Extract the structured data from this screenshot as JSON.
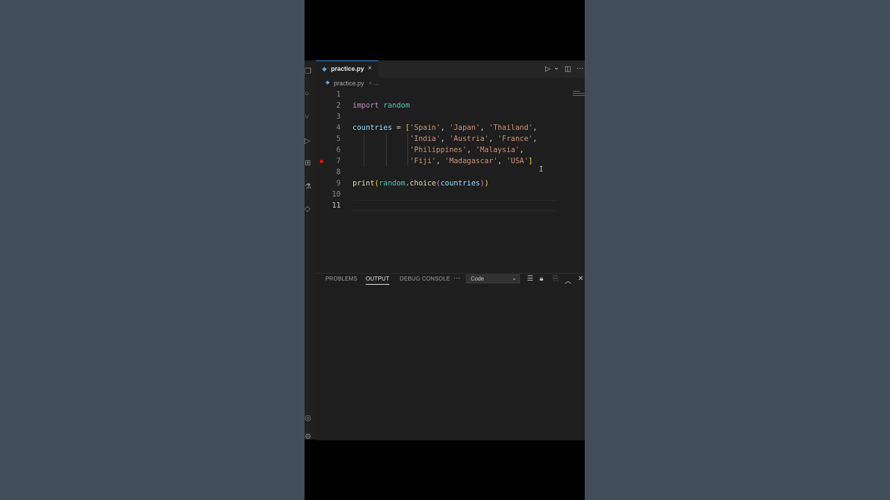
{
  "tab": {
    "filename": "practice.py",
    "close": "×"
  },
  "breadcrumb": {
    "file": "practice.py",
    "sep": "›  …"
  },
  "toolbar": {
    "run": "▷",
    "run_menu": "⌄",
    "split": "◫",
    "more": "···"
  },
  "code_lines": [
    {
      "num": "1"
    },
    {
      "num": "2",
      "tokens": [
        [
          "kw",
          "import"
        ],
        [
          "op",
          " "
        ],
        [
          "mod",
          "random"
        ]
      ]
    },
    {
      "num": "3"
    },
    {
      "num": "4",
      "tokens": [
        [
          "var",
          "countries"
        ],
        [
          "op",
          " = "
        ],
        [
          "br",
          "["
        ],
        [
          "str",
          "'Spain'"
        ],
        [
          "op",
          ", "
        ],
        [
          "str",
          "'Japan'"
        ],
        [
          "op",
          ", "
        ],
        [
          "str",
          "'Thailand'"
        ],
        [
          "op",
          ","
        ]
      ]
    },
    {
      "num": "5",
      "tokens": [
        [
          "op",
          "             "
        ],
        [
          "str",
          "'India'"
        ],
        [
          "op",
          ", "
        ],
        [
          "str",
          "'Austria'"
        ],
        [
          "op",
          ", "
        ],
        [
          "str",
          "'France'"
        ],
        [
          "op",
          ","
        ]
      ]
    },
    {
      "num": "6",
      "tokens": [
        [
          "op",
          "             "
        ],
        [
          "str",
          "'Philippines'"
        ],
        [
          "op",
          ", "
        ],
        [
          "str",
          "'Malaysia'"
        ],
        [
          "op",
          ","
        ]
      ]
    },
    {
      "num": "7",
      "tokens": [
        [
          "op",
          "             "
        ],
        [
          "str",
          "'Fiji'"
        ],
        [
          "op",
          ", "
        ],
        [
          "str",
          "'Madagascar'"
        ],
        [
          "op",
          ", "
        ],
        [
          "str",
          "'USA'"
        ],
        [
          "br",
          "]"
        ]
      ]
    },
    {
      "num": "8"
    },
    {
      "num": "9",
      "tokens": [
        [
          "fn",
          "print"
        ],
        [
          "br",
          "("
        ],
        [
          "mod",
          "random"
        ],
        [
          "op",
          "."
        ],
        [
          "fn",
          "choice"
        ],
        [
          "br2",
          "("
        ],
        [
          "var",
          "countries"
        ],
        [
          "br2",
          ")"
        ],
        [
          "br",
          ")"
        ]
      ]
    },
    {
      "num": "10"
    },
    {
      "num": "11"
    }
  ],
  "panel": {
    "tabs": [
      "PROBLEMS",
      "OUTPUT",
      "DEBUG CONSOLE"
    ],
    "active_tab": "OUTPUT",
    "more": "···",
    "channel": "Code",
    "icons": [
      "list-filter",
      "lock",
      "clear",
      "maximize",
      "close"
    ]
  },
  "colors": {
    "accent": "#3c8fd6",
    "breakpoint": "#e51400",
    "string": "#ce9178",
    "keyword": "#c586c0"
  }
}
